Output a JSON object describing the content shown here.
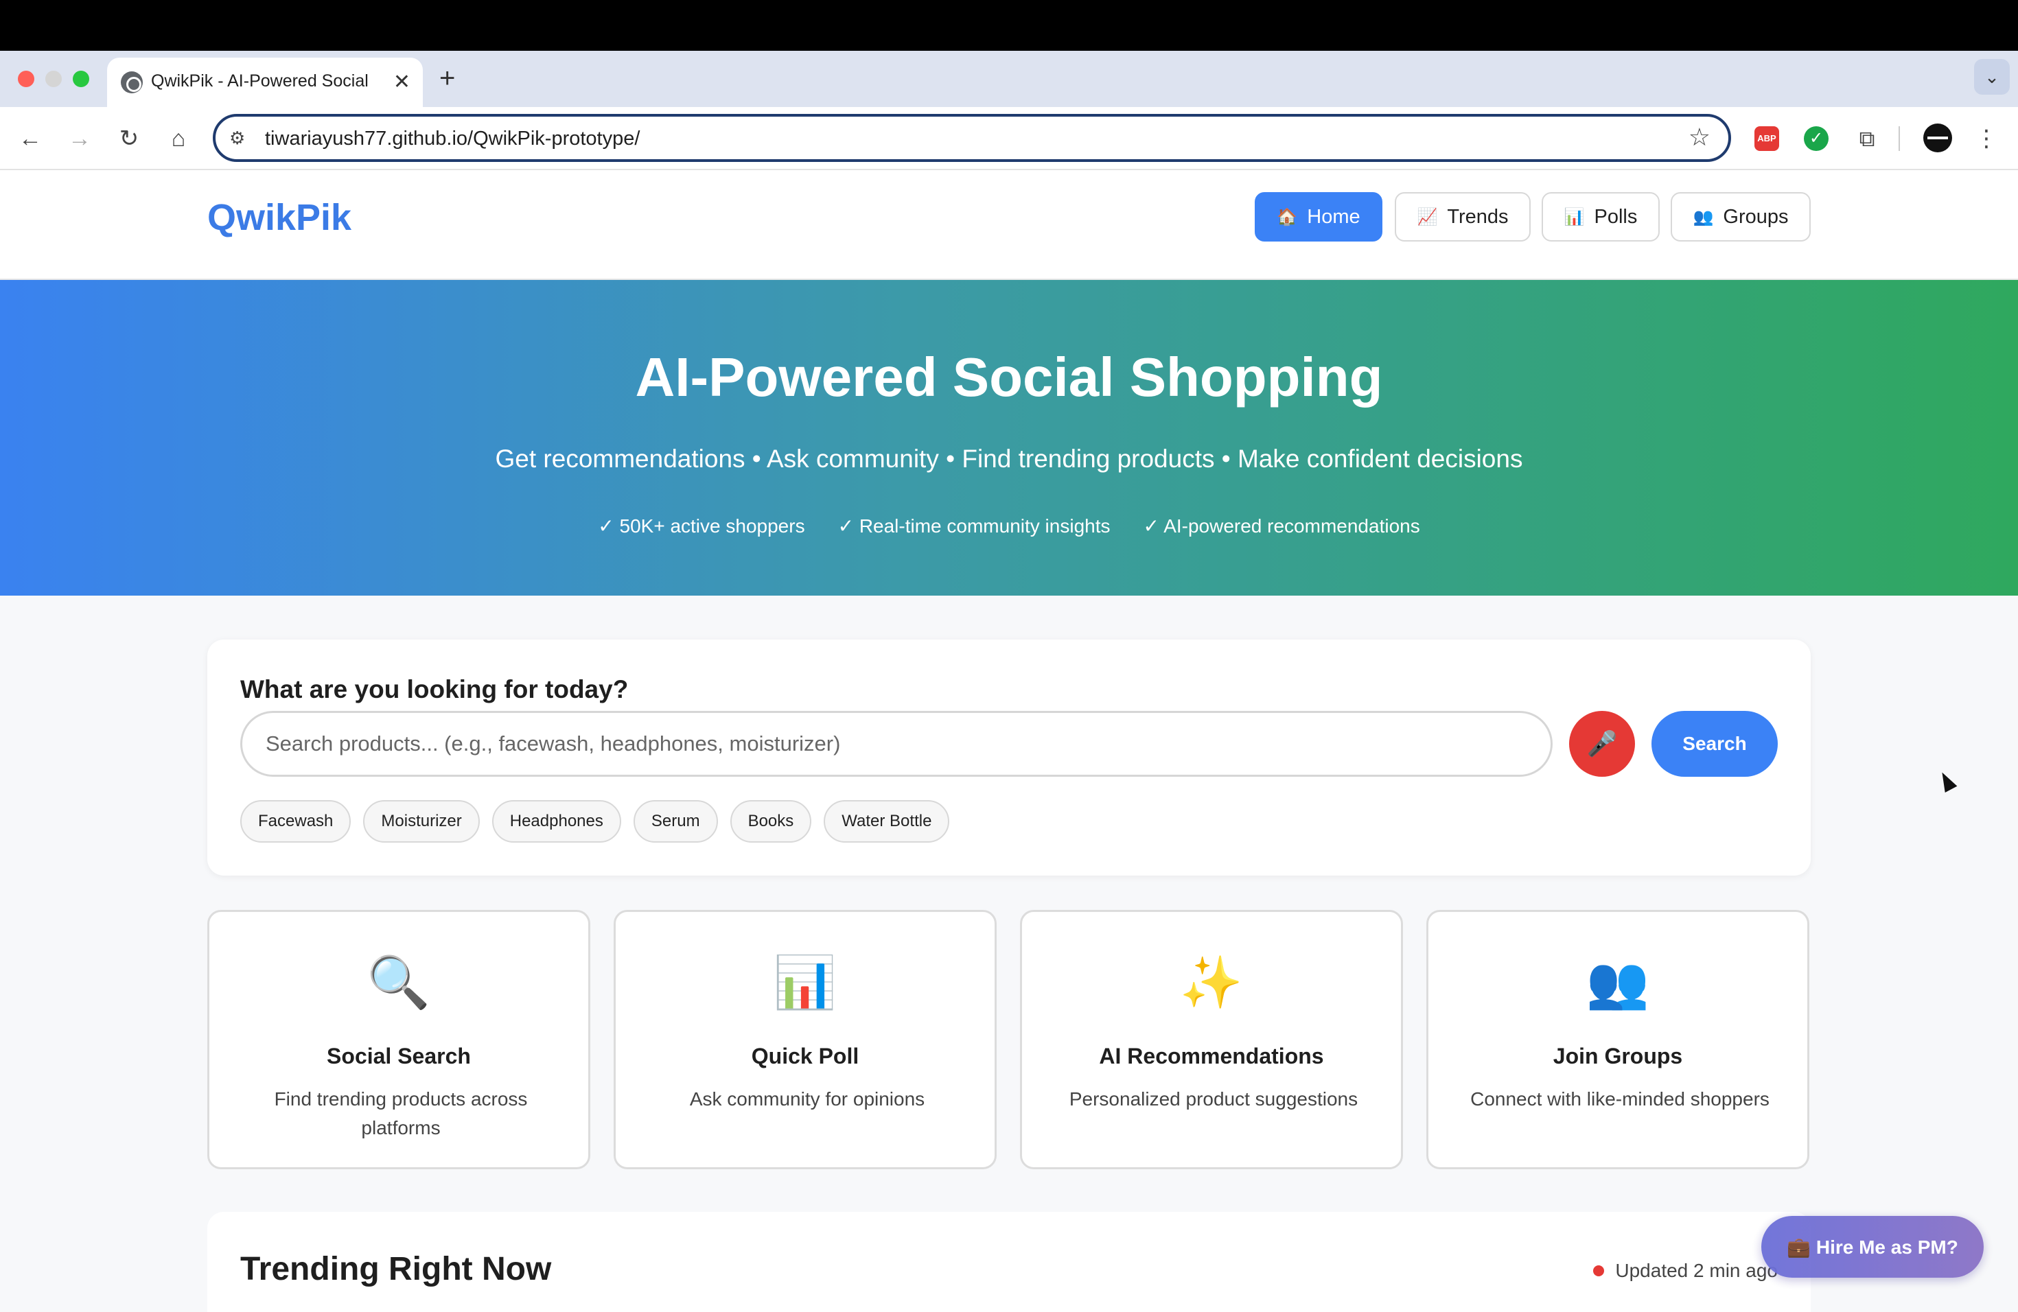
{
  "browser": {
    "tab_title": "QwikPik - AI-Powered Social",
    "tab_close": "✕",
    "new_tab": "+",
    "url": "tiwariayush77.github.io/QwikPik-prototype/",
    "icons": [
      "back-icon",
      "forward-icon",
      "reload-icon",
      "home-icon",
      "site-settings-icon",
      "bookmark-star-icon",
      "adblock-icon",
      "check-extension-icon",
      "extensions-puzzle-icon",
      "profile-avatar",
      "more-menu-icon",
      "tab-search-icon"
    ],
    "glyphs": {
      "back": "←",
      "forward": "→",
      "reload": "↻",
      "home": "⌂",
      "tune": "⚙",
      "star": "☆",
      "abp": "ABP",
      "check": "✓",
      "puzzle": "⧉",
      "kebab": "⋮",
      "chevron": "⌄"
    }
  },
  "header": {
    "logo": "QwikPik",
    "nav": [
      {
        "emoji": "🏠",
        "label": "Home",
        "active": true
      },
      {
        "emoji": "📈",
        "label": "Trends",
        "active": false
      },
      {
        "emoji": "📊",
        "label": "Polls",
        "active": false
      },
      {
        "emoji": "👥",
        "label": "Groups",
        "active": false
      }
    ]
  },
  "hero": {
    "title": "AI-Powered Social Shopping",
    "subtitle": "Get recommendations • Ask community • Find trending products • Make confident decisions",
    "features": [
      "✓ 50K+ active shoppers",
      "✓ Real-time community insights",
      "✓ AI-powered recommendations"
    ]
  },
  "search": {
    "question": "What are you looking for today?",
    "placeholder": "Search products... (e.g., facewash, headphones, moisturizer)",
    "mic_emoji": "🎤",
    "button": "Search",
    "chips": [
      "Facewash",
      "Moisturizer",
      "Headphones",
      "Serum",
      "Books",
      "Water Bottle"
    ]
  },
  "features": [
    {
      "emoji": "🔍",
      "icon": "magnifier-icon",
      "title": "Social Search",
      "desc": "Find trending products across platforms"
    },
    {
      "emoji": "📊",
      "icon": "bar-chart-icon",
      "title": "Quick Poll",
      "desc": "Ask community for opinions"
    },
    {
      "emoji": "✨",
      "icon": "sparkles-icon",
      "title": "AI Recommendations",
      "desc": "Personalized product suggestions"
    },
    {
      "emoji": "👥",
      "icon": "people-icon",
      "title": "Join Groups",
      "desc": "Connect with like-minded shoppers"
    }
  ],
  "trending": {
    "title": "Trending Right Now",
    "updated": "Updated 2 min ago"
  },
  "hire": {
    "label": "💼 Hire Me as PM?"
  },
  "colors": {
    "accent": "#3b82f6",
    "hero_start": "#3a82f0",
    "hero_end": "#2fa85e",
    "mic": "#e53935"
  }
}
